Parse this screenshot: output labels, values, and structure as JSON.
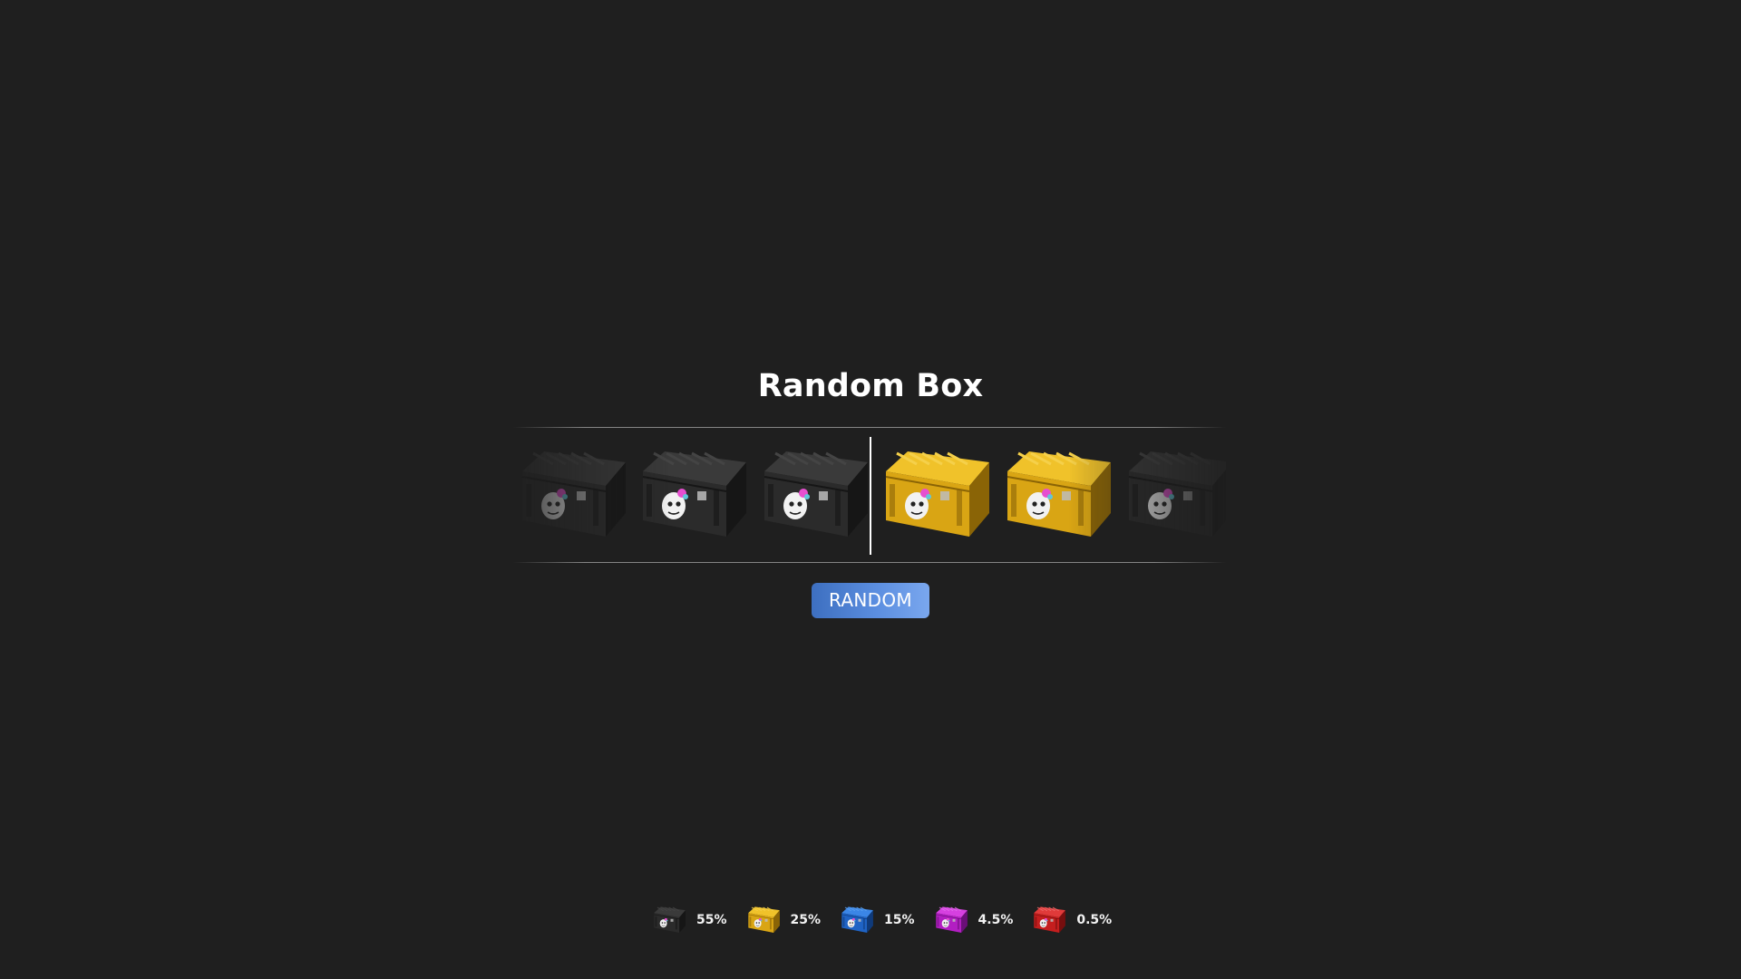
{
  "title": "Random Box",
  "button": {
    "label": "RANDOM"
  },
  "palette": {
    "black": {
      "body": "#2b2b2b",
      "light": "#3a3a3a",
      "dark": "#161616",
      "ridge": "#444444"
    },
    "yellow": {
      "body": "#d9a514",
      "light": "#f0c22a",
      "dark": "#8a6406",
      "ridge": "#f5d04a"
    },
    "blue": {
      "body": "#1f63c4",
      "light": "#3b86e6",
      "dark": "#0f3a7a",
      "ridge": "#5aa0f0"
    },
    "purple": {
      "body": "#b21ec2",
      "light": "#d640e0",
      "dark": "#6a0f78",
      "ridge": "#e46aee"
    },
    "red": {
      "body": "#c41e1e",
      "light": "#e03a3a",
      "dark": "#760e0e",
      "ridge": "#ee6a6a"
    }
  },
  "roller": {
    "items": [
      {
        "color": "black"
      },
      {
        "color": "black"
      },
      {
        "color": "black"
      },
      {
        "color": "yellow"
      },
      {
        "color": "yellow"
      },
      {
        "color": "black"
      }
    ]
  },
  "odds": [
    {
      "color": "black",
      "percent": "55%"
    },
    {
      "color": "yellow",
      "percent": "25%"
    },
    {
      "color": "blue",
      "percent": "15%"
    },
    {
      "color": "purple",
      "percent": "4.5%"
    },
    {
      "color": "red",
      "percent": "0.5%"
    }
  ]
}
